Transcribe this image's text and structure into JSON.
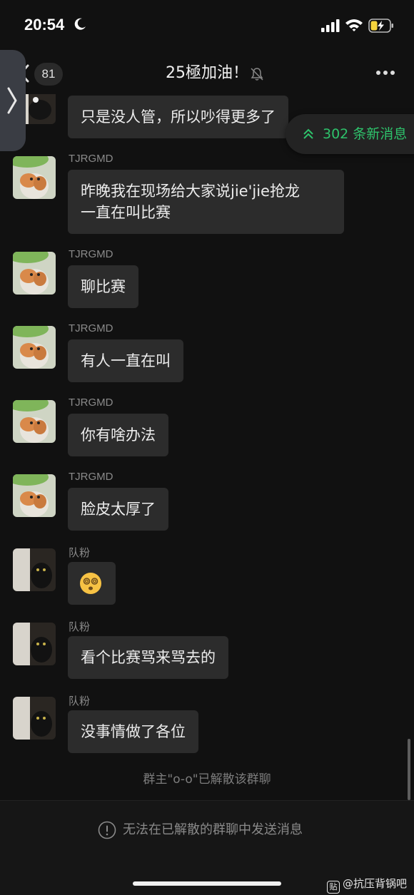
{
  "status_bar": {
    "time": "20:54"
  },
  "nav": {
    "unread_count": "81",
    "title": "25極加油！"
  },
  "new_messages": {
    "label": "302 条新消息"
  },
  "messages": [
    {
      "sender": "",
      "text": "只是没人管，所以吵得更多了",
      "avatar": "cat-dark-partial"
    },
    {
      "sender": "TJRGMD",
      "text": "昨晚我在现场给大家说jie'jie抢龙\n一直在叫比赛",
      "avatar": "kitten-orange"
    },
    {
      "sender": "TJRGMD",
      "text": "聊比赛",
      "avatar": "kitten-orange"
    },
    {
      "sender": "TJRGMD",
      "text": "有人一直在叫",
      "avatar": "kitten-orange"
    },
    {
      "sender": "TJRGMD",
      "text": "你有啥办法",
      "avatar": "kitten-orange"
    },
    {
      "sender": "TJRGMD",
      "text": "脸皮太厚了",
      "avatar": "kitten-orange"
    },
    {
      "sender": "队粉",
      "text": "😵‍💫",
      "avatar": "cat-black"
    },
    {
      "sender": "队粉",
      "text": "看个比赛骂来骂去的",
      "avatar": "cat-black"
    },
    {
      "sender": "队粉",
      "text": "没事情做了各位",
      "avatar": "cat-black"
    }
  ],
  "system_note": "群主\"o-o\"已解散该群聊",
  "bottom": {
    "notice": "无法在已解散的群聊中发送消息",
    "watermark": "@抗压背锅吧",
    "watermark_badge": "贴"
  },
  "colors": {
    "background": "#111111",
    "bubble": "#2c2c2c",
    "accent_green": "#2ec26b",
    "battery_charge": "#f5d43c"
  }
}
